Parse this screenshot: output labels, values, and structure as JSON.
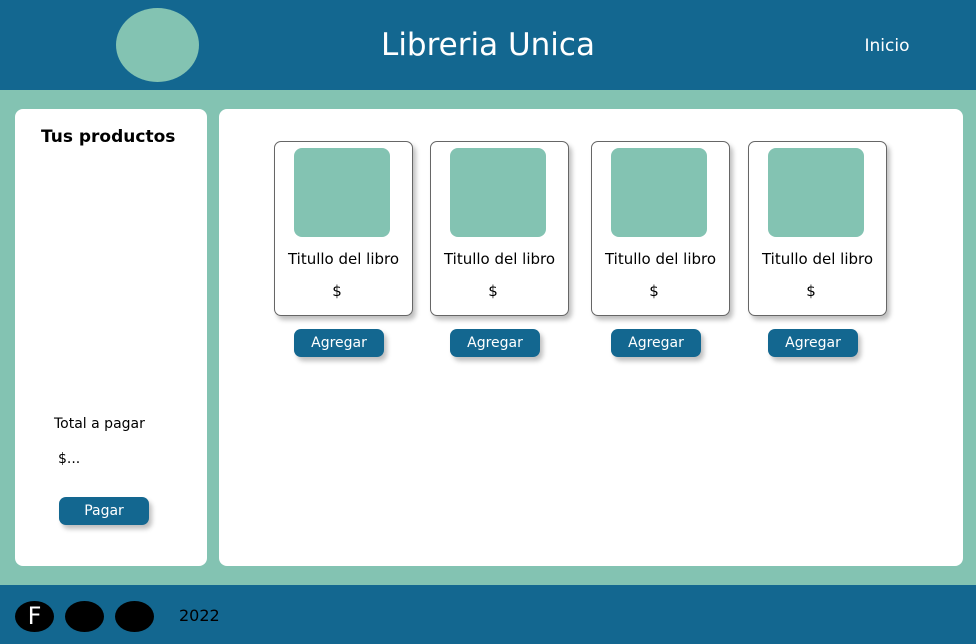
{
  "header": {
    "title": "Libreria Unica",
    "nav_home": "Inicio",
    "logo_icon": "logo-circle-icon"
  },
  "sidebar": {
    "title": "Tus productos",
    "total_label": "Total a pagar",
    "total_value": "$...",
    "pay_label": "Pagar"
  },
  "products": [
    {
      "title": "Titullo del libro",
      "price": "$",
      "add_label": "Agregar"
    },
    {
      "title": "Titullo del libro",
      "price": "$",
      "add_label": "Agregar"
    },
    {
      "title": "Titullo del libro",
      "price": "$",
      "add_label": "Agregar"
    },
    {
      "title": "Titullo del libro",
      "price": "$",
      "add_label": "Agregar"
    }
  ],
  "footer": {
    "social": [
      {
        "icon": "facebook-icon",
        "letter": "F"
      },
      {
        "icon": "social-icon"
      },
      {
        "icon": "social-icon"
      }
    ],
    "year": "2022"
  },
  "colors": {
    "primary": "#136790",
    "accent": "#83c3b2",
    "surface": "#ffffff"
  }
}
